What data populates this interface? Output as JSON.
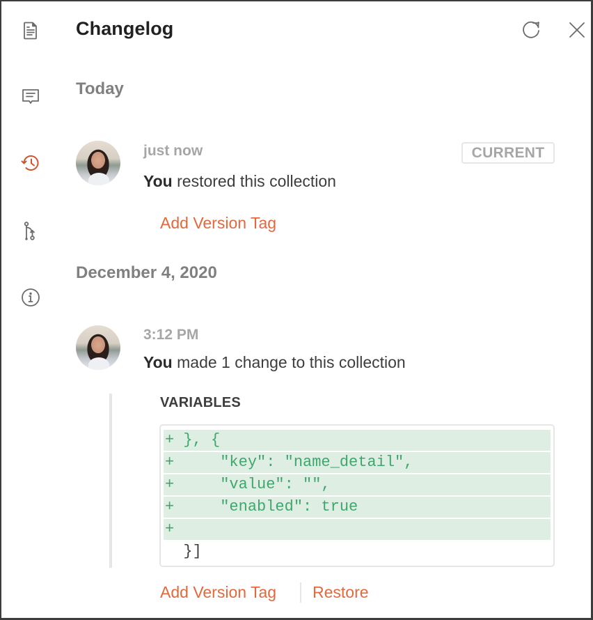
{
  "header": {
    "title": "Changelog",
    "refresh_icon": "refresh-icon",
    "close_icon": "close-icon"
  },
  "sidebar": {
    "items": [
      {
        "name": "documentation",
        "icon": "document-icon",
        "active": false
      },
      {
        "name": "comments",
        "icon": "comment-icon",
        "active": false
      },
      {
        "name": "changelog",
        "icon": "history-icon",
        "active": true
      },
      {
        "name": "pull-requests",
        "icon": "fork-icon",
        "active": false
      },
      {
        "name": "info",
        "icon": "info-icon",
        "active": false
      }
    ]
  },
  "colors": {
    "accent": "#e0693e",
    "active_icon": "#d0542e",
    "icon": "#6b6b6b",
    "diff_add_bg": "#deeee3",
    "diff_add_text": "#3fa66d"
  },
  "groups": [
    {
      "date": "Today",
      "entries": [
        {
          "time": "just now",
          "actor": "You",
          "action": "restored this collection",
          "badge": "CURRENT",
          "actions": [
            "Add Version Tag"
          ]
        }
      ]
    },
    {
      "date": "December 4, 2020",
      "entries": [
        {
          "time": "3:12 PM",
          "actor": "You",
          "action": "made 1 change to this collection",
          "section": "VARIABLES",
          "diff": [
            {
              "type": "add",
              "text": "+ }, {"
            },
            {
              "type": "add",
              "text": "+     \"key\": \"name_detail\","
            },
            {
              "type": "add",
              "text": "+     \"value\": \"\","
            },
            {
              "type": "add",
              "text": "+     \"enabled\": true"
            },
            {
              "type": "add",
              "text": "+"
            },
            {
              "type": "ctx",
              "text": "  }]"
            }
          ],
          "actions": [
            "Add Version Tag",
            "Restore"
          ]
        }
      ]
    }
  ]
}
